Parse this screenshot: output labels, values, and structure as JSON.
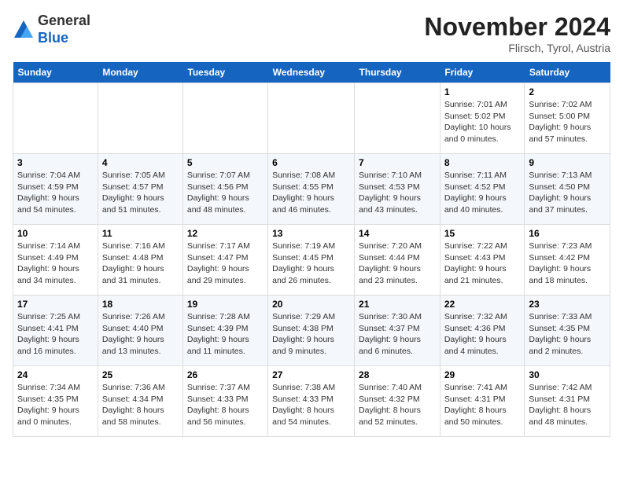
{
  "header": {
    "logo_general": "General",
    "logo_blue": "Blue",
    "title": "November 2024",
    "location": "Flirsch, Tyrol, Austria"
  },
  "days_of_week": [
    "Sunday",
    "Monday",
    "Tuesday",
    "Wednesday",
    "Thursday",
    "Friday",
    "Saturday"
  ],
  "weeks": [
    [
      {
        "day": "",
        "info": ""
      },
      {
        "day": "",
        "info": ""
      },
      {
        "day": "",
        "info": ""
      },
      {
        "day": "",
        "info": ""
      },
      {
        "day": "",
        "info": ""
      },
      {
        "day": "1",
        "info": "Sunrise: 7:01 AM\nSunset: 5:02 PM\nDaylight: 10 hours and 0 minutes."
      },
      {
        "day": "2",
        "info": "Sunrise: 7:02 AM\nSunset: 5:00 PM\nDaylight: 9 hours and 57 minutes."
      }
    ],
    [
      {
        "day": "3",
        "info": "Sunrise: 7:04 AM\nSunset: 4:59 PM\nDaylight: 9 hours and 54 minutes."
      },
      {
        "day": "4",
        "info": "Sunrise: 7:05 AM\nSunset: 4:57 PM\nDaylight: 9 hours and 51 minutes."
      },
      {
        "day": "5",
        "info": "Sunrise: 7:07 AM\nSunset: 4:56 PM\nDaylight: 9 hours and 48 minutes."
      },
      {
        "day": "6",
        "info": "Sunrise: 7:08 AM\nSunset: 4:55 PM\nDaylight: 9 hours and 46 minutes."
      },
      {
        "day": "7",
        "info": "Sunrise: 7:10 AM\nSunset: 4:53 PM\nDaylight: 9 hours and 43 minutes."
      },
      {
        "day": "8",
        "info": "Sunrise: 7:11 AM\nSunset: 4:52 PM\nDaylight: 9 hours and 40 minutes."
      },
      {
        "day": "9",
        "info": "Sunrise: 7:13 AM\nSunset: 4:50 PM\nDaylight: 9 hours and 37 minutes."
      }
    ],
    [
      {
        "day": "10",
        "info": "Sunrise: 7:14 AM\nSunset: 4:49 PM\nDaylight: 9 hours and 34 minutes."
      },
      {
        "day": "11",
        "info": "Sunrise: 7:16 AM\nSunset: 4:48 PM\nDaylight: 9 hours and 31 minutes."
      },
      {
        "day": "12",
        "info": "Sunrise: 7:17 AM\nSunset: 4:47 PM\nDaylight: 9 hours and 29 minutes."
      },
      {
        "day": "13",
        "info": "Sunrise: 7:19 AM\nSunset: 4:45 PM\nDaylight: 9 hours and 26 minutes."
      },
      {
        "day": "14",
        "info": "Sunrise: 7:20 AM\nSunset: 4:44 PM\nDaylight: 9 hours and 23 minutes."
      },
      {
        "day": "15",
        "info": "Sunrise: 7:22 AM\nSunset: 4:43 PM\nDaylight: 9 hours and 21 minutes."
      },
      {
        "day": "16",
        "info": "Sunrise: 7:23 AM\nSunset: 4:42 PM\nDaylight: 9 hours and 18 minutes."
      }
    ],
    [
      {
        "day": "17",
        "info": "Sunrise: 7:25 AM\nSunset: 4:41 PM\nDaylight: 9 hours and 16 minutes."
      },
      {
        "day": "18",
        "info": "Sunrise: 7:26 AM\nSunset: 4:40 PM\nDaylight: 9 hours and 13 minutes."
      },
      {
        "day": "19",
        "info": "Sunrise: 7:28 AM\nSunset: 4:39 PM\nDaylight: 9 hours and 11 minutes."
      },
      {
        "day": "20",
        "info": "Sunrise: 7:29 AM\nSunset: 4:38 PM\nDaylight: 9 hours and 9 minutes."
      },
      {
        "day": "21",
        "info": "Sunrise: 7:30 AM\nSunset: 4:37 PM\nDaylight: 9 hours and 6 minutes."
      },
      {
        "day": "22",
        "info": "Sunrise: 7:32 AM\nSunset: 4:36 PM\nDaylight: 9 hours and 4 minutes."
      },
      {
        "day": "23",
        "info": "Sunrise: 7:33 AM\nSunset: 4:35 PM\nDaylight: 9 hours and 2 minutes."
      }
    ],
    [
      {
        "day": "24",
        "info": "Sunrise: 7:34 AM\nSunset: 4:35 PM\nDaylight: 9 hours and 0 minutes."
      },
      {
        "day": "25",
        "info": "Sunrise: 7:36 AM\nSunset: 4:34 PM\nDaylight: 8 hours and 58 minutes."
      },
      {
        "day": "26",
        "info": "Sunrise: 7:37 AM\nSunset: 4:33 PM\nDaylight: 8 hours and 56 minutes."
      },
      {
        "day": "27",
        "info": "Sunrise: 7:38 AM\nSunset: 4:33 PM\nDaylight: 8 hours and 54 minutes."
      },
      {
        "day": "28",
        "info": "Sunrise: 7:40 AM\nSunset: 4:32 PM\nDaylight: 8 hours and 52 minutes."
      },
      {
        "day": "29",
        "info": "Sunrise: 7:41 AM\nSunset: 4:31 PM\nDaylight: 8 hours and 50 minutes."
      },
      {
        "day": "30",
        "info": "Sunrise: 7:42 AM\nSunset: 4:31 PM\nDaylight: 8 hours and 48 minutes."
      }
    ]
  ]
}
